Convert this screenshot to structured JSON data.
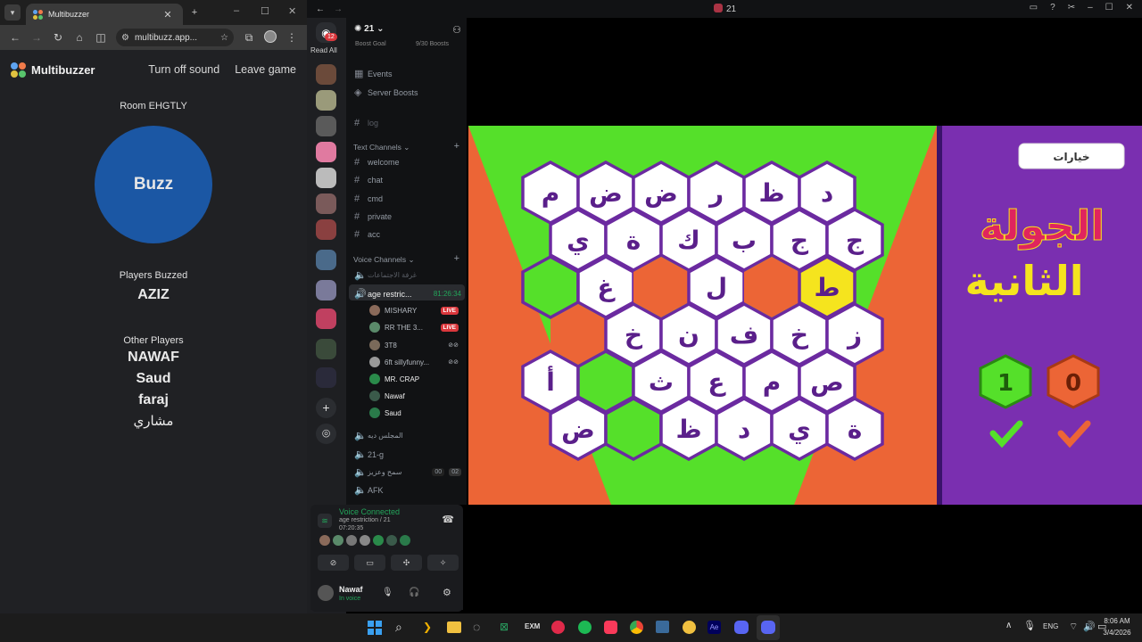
{
  "browser": {
    "tab_title": "Multibuzzer",
    "url": "multibuzz.app...",
    "new_tab_label": "+",
    "window_controls": [
      "–",
      "☐",
      "✕"
    ]
  },
  "app": {
    "brand": "Multibuzzer",
    "nav": [
      "Turn off sound",
      "Leave game"
    ],
    "room_label": "Room EHGTLY",
    "buzz_label": "Buzz",
    "players_buzzed_label": "Players Buzzed",
    "players_buzzed": [
      "AZIZ"
    ],
    "other_players_label": "Other Players",
    "other_players": [
      "NAWAF",
      "Saud",
      "faraj",
      "مشاري"
    ],
    "logo_colors": [
      "#5ea3f0",
      "#f07b4a",
      "#e0c240",
      "#58c46c"
    ]
  },
  "discord": {
    "window_title": "21",
    "read_all": "Read All",
    "badge_count": "12",
    "server_name": "21",
    "boost_goal": "Boost Goal",
    "boost_count": "9/30 Boosts",
    "menu": [
      "Events",
      "Server Boosts"
    ],
    "log_channel": "log",
    "text_category": "Text Channels",
    "text_channels": [
      "welcome",
      "chat",
      "cmd",
      "private",
      "acc"
    ],
    "voice_category": "Voice Channels",
    "voice_channels_top": [
      "غرفة الاجتماعات"
    ],
    "active_voice": {
      "name": "age restric...",
      "timer": "81:26:34"
    },
    "voice_users": [
      {
        "name": "MISHARY",
        "live": "LIVE"
      },
      {
        "name": "RR THE 3...",
        "live": "LIVE"
      },
      {
        "name": "3T8",
        "live": ""
      },
      {
        "name": "6ft sillyfunny...",
        "live": ""
      },
      {
        "name": "MR. CRAP",
        "live": ""
      },
      {
        "name": "Nawaf",
        "live": ""
      },
      {
        "name": "Saud",
        "live": ""
      }
    ],
    "voice_channels_bottom": [
      "المجلس ديه",
      "21-g",
      "سمح وعزيز",
      "AFK"
    ],
    "counter_a": "00",
    "counter_b": "02",
    "voice_connected": {
      "status": "Voice Connected",
      "channel": "age restriction / 21",
      "time": "07:20:35"
    },
    "user": {
      "name": "Nawaf",
      "status": "In voice"
    }
  },
  "game": {
    "options_button": "خيارات",
    "round_title_line1": "الجولة",
    "round_title_line2": "الثانية",
    "team_green_score": "1",
    "team_orange_score": "0",
    "colors": {
      "green": "#55e02a",
      "orange": "#ec6536",
      "purple": "#7a2fb0",
      "yellow": "#f5e41e",
      "hex_border": "#6b2aa0"
    },
    "grid": [
      [
        "م",
        "ض",
        "ض",
        "ر",
        "ظ",
        "د"
      ],
      [
        "ي",
        "ة",
        "ك",
        "ب",
        "ج",
        "ج"
      ],
      [
        "",
        "غ",
        "",
        "ل",
        "",
        "ط"
      ],
      [
        "",
        "خ",
        "ن",
        "ف",
        "خ",
        "ز"
      ],
      [
        "أ",
        "",
        "ث",
        "ع",
        "م",
        "ص"
      ],
      [
        "ض",
        "",
        "ظ",
        "د",
        "ي",
        "ة"
      ]
    ],
    "cell_states": [
      [
        "w",
        "w",
        "w",
        "w",
        "w",
        "w"
      ],
      [
        "w",
        "w",
        "w",
        "w",
        "w",
        "w"
      ],
      [
        "g",
        "w",
        "o",
        "w",
        "o",
        "y"
      ],
      [
        "o",
        "w",
        "w",
        "w",
        "w",
        "w"
      ],
      [
        "w",
        "g",
        "w",
        "w",
        "w",
        "w"
      ],
      [
        "w",
        "g",
        "w",
        "w",
        "w",
        "w"
      ]
    ]
  },
  "taskbar": {
    "lang": "ENG",
    "time": "8:06 AM",
    "date": "3/4/2026"
  }
}
